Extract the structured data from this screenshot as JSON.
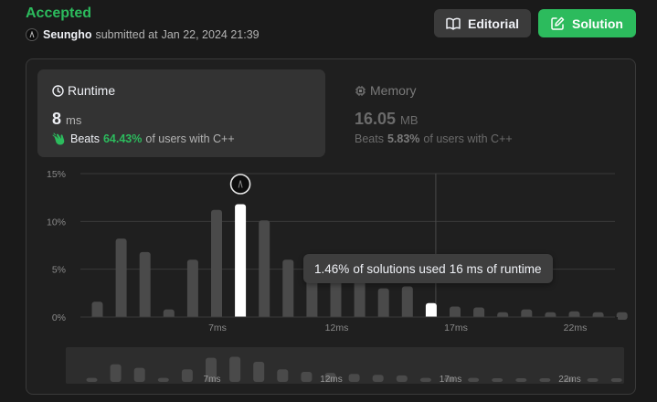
{
  "header": {
    "status": "Accepted",
    "user": "Seungho",
    "submitted_prefix": "submitted at",
    "submitted_time": "Jan 22, 2024 21:39"
  },
  "buttons": {
    "editorial": "Editorial",
    "solution": "Solution"
  },
  "runtime": {
    "label": "Runtime",
    "value": "8",
    "unit": "ms",
    "beats_label": "Beats",
    "beats_pct": "64.43%",
    "beats_suffix": "of users with C++"
  },
  "memory": {
    "label": "Memory",
    "value": "16.05",
    "unit": "MB",
    "beats_label": "Beats",
    "beats_pct": "5.83%",
    "beats_suffix": "of users with C++"
  },
  "tooltip": {
    "pct": "1.46%",
    "text1": "of solutions used",
    "ms": "16 ms",
    "text2": "of runtime"
  },
  "colors": {
    "accent": "#2cbb5d",
    "bar": "#4a4a4a",
    "bar_selected": "#ffffff"
  },
  "chart_data": {
    "type": "bar",
    "yticks": [
      "15%",
      "10%",
      "5%",
      "0%"
    ],
    "ylim": [
      0,
      15
    ],
    "x": [
      1,
      2,
      3,
      4,
      5,
      6,
      7,
      8,
      9,
      10,
      11,
      12,
      13,
      14,
      15,
      16,
      17,
      18,
      19,
      20,
      21,
      22,
      23
    ],
    "xtick_labels": [
      {
        "x": 6,
        "label": "7ms"
      },
      {
        "x": 11,
        "label": "12ms"
      },
      {
        "x": 16,
        "label": "17ms"
      },
      {
        "x": 21,
        "label": "22ms"
      }
    ],
    "values": [
      1.6,
      8.2,
      6.8,
      0.8,
      6.0,
      11.2,
      11.8,
      10.1,
      6.0,
      4.9,
      4.1,
      3.8,
      3.0,
      3.2,
      1.46,
      1.1,
      1.0,
      0.5,
      0.8,
      0.5,
      0.6,
      0.5,
      0.5
    ],
    "selected_x": 7,
    "hover_x": 15,
    "grid": true
  },
  "navigator": {
    "values": [
      0.8,
      3.5,
      2.8,
      0.8,
      2.5,
      4.8,
      5.0,
      4.0,
      2.5,
      2.0,
      1.8,
      1.6,
      1.4,
      1.3,
      0.8,
      1.0,
      0.8,
      0.6,
      0.7,
      0.6,
      0.6,
      0.5,
      0.5
    ],
    "xtick_labels": [
      {
        "x": 6,
        "label": "7ms"
      },
      {
        "x": 11,
        "label": "12ms"
      },
      {
        "x": 16,
        "label": "17ms"
      },
      {
        "x": 21,
        "label": "22ms"
      }
    ]
  }
}
